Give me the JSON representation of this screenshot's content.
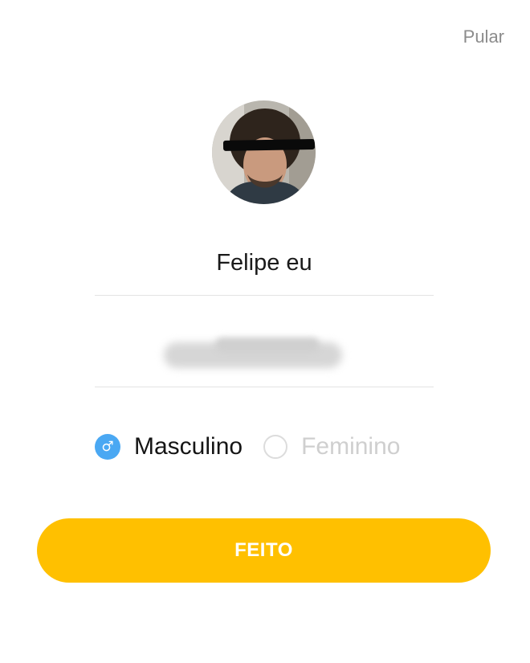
{
  "header": {
    "skip_label": "Pular"
  },
  "profile": {
    "avatar_icon": "user-photo",
    "name_value": "Felipe eu",
    "birthday_value": ""
  },
  "gender": {
    "selected": "Masculino",
    "options": [
      {
        "label": "Masculino",
        "icon": "male-symbol-icon",
        "checked": true
      },
      {
        "label": "Feminino",
        "icon": "radio-empty-icon",
        "checked": false
      }
    ]
  },
  "actions": {
    "done_label": "FEITO"
  },
  "colors": {
    "accent": "#ffc000",
    "radio_selected": "#4aa8f3",
    "muted_text": "#8c8c8c",
    "inactive_text": "#cfcfcf",
    "divider": "#e3e3e3"
  }
}
